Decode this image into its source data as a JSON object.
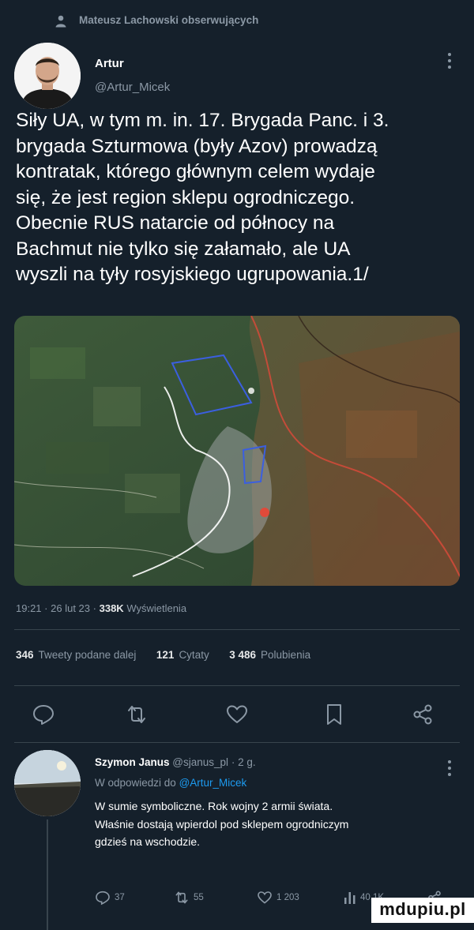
{
  "header": {
    "follow_context": "Mateusz Lachowski obserwujących",
    "person_icon": "person-icon"
  },
  "tweet": {
    "author_name": "Artur",
    "author_handle": "@Artur_Micek",
    "text_lines": [
      "Siły UA, w tym m. in. 17. Brygada Panc. i 3.",
      "brygada Szturmowa (były Azov) prowadzą",
      "kontratak, którego głównym celem wydaje",
      "się, że jest region sklepu ogrodniczego.",
      "Obecnie RUS natarcie od północy na",
      "Bachmut nie tylko się załamało, ale UA",
      "wyszli na tyły rosyjskiego ugrupowania.1/"
    ],
    "time": "19:21",
    "date": "26 lut 23",
    "views_count": "338K",
    "views_label": "Wyświetlenia",
    "sep": "·"
  },
  "stats": {
    "retweets_count": "346",
    "retweets_label": "Tweety podane dalej",
    "quotes_count": "121",
    "quotes_label": "Cytaty",
    "likes_count": "3 486",
    "likes_label": "Polubienia"
  },
  "actions": [
    "comment-icon",
    "retweet-icon",
    "heart-icon",
    "bookmark-icon",
    "share-icon"
  ],
  "reply": {
    "author_name": "Szymon Janus",
    "author_handle": "@sjanus_pl",
    "age": "2 g.",
    "sep": "·",
    "reply_to_prefix": "W odpowiedzi do",
    "reply_to_handle": "@Artur_Micek",
    "text_lines": [
      "W sumie symboliczne. Rok wojny 2 armii świata.",
      "Właśnie dostają wpierdol pod sklepem ogrodniczym",
      "gdzieś na wschodzie."
    ],
    "comments": "37",
    "retweets": "55",
    "likes": "1 203",
    "views": "40,1K"
  },
  "watermark": "mdupiu.pl",
  "colors": {
    "background": "#15202b",
    "text": "#e7e9ea",
    "muted": "#8b98a5",
    "link": "#1d9bf0",
    "divider": "#38444d"
  }
}
